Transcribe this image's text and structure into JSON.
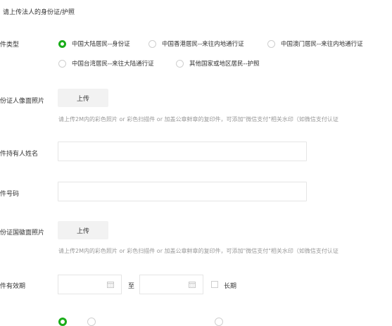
{
  "section_title": "请上传法人的身份证/护照",
  "fields": {
    "id_type_label": "件类型",
    "id_front_label": "份证人像面照片",
    "holder_name_label": "件持有人姓名",
    "id_number_label": "件号码",
    "id_back_label": "份证国徽面照片",
    "validity_label": "件有效期"
  },
  "id_types": [
    {
      "label": "中国大陆居民--身份证",
      "checked": true
    },
    {
      "label": "中国香港居民--来往内地通行证",
      "checked": false
    },
    {
      "label": "中国澳门居民--来往内地通行证",
      "checked": false
    },
    {
      "label": "中国台湾居民--来往大陆通行证",
      "checked": false
    },
    {
      "label": "其他国家或地区居民--护照",
      "checked": false
    }
  ],
  "upload": {
    "front_button": "上传",
    "back_button": "上传",
    "hint": "请上传2M内的彩色照片 or 彩色扫描件 or 加盖公章鲜章的复印件，可添加\"微信支付\"相关水印（如微信支付认证"
  },
  "validity": {
    "separator": "至",
    "long_term_label": "长期"
  },
  "colors": {
    "accent": "#1aad19",
    "border": "#e5e5e5",
    "button_bg": "#f2f2f2",
    "hint_text": "#999999"
  }
}
